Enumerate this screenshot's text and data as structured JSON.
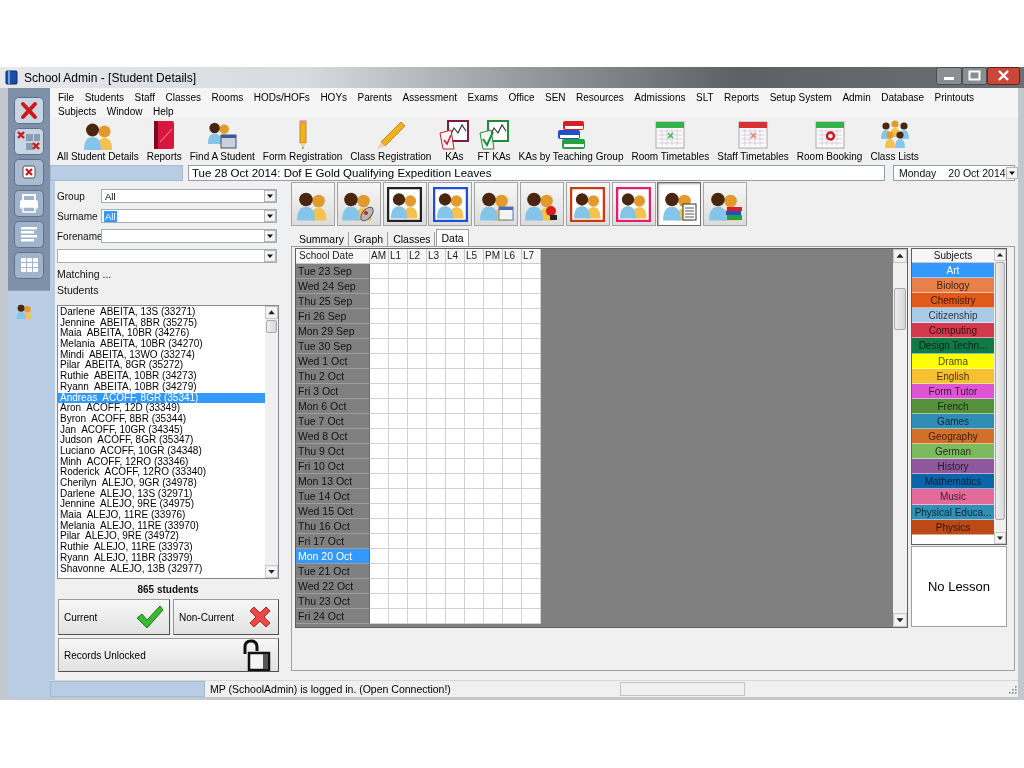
{
  "window": {
    "title": "School Admin - [Student Details]"
  },
  "side_buttons": [
    {
      "kind": "close"
    },
    {
      "kind": "close-all"
    },
    {
      "kind": "close-box"
    },
    {
      "kind": "print"
    },
    {
      "kind": "list"
    },
    {
      "kind": "grid"
    }
  ],
  "menu_rows": [
    [
      "File",
      "Students",
      "Staff",
      "Classes",
      "Rooms",
      "HODs/HOFs",
      "HOYs",
      "Parents",
      "Assessment",
      "Exams",
      "Office",
      "SEN",
      "Resources",
      "Admissions",
      "SLT",
      "Reports",
      "Setup System",
      "Admin",
      "Database",
      "Printouts"
    ],
    [
      "Subjects",
      "Window",
      "Help"
    ]
  ],
  "toolbar": [
    {
      "label": "All Student Details",
      "kind": "people"
    },
    {
      "label": "Reports",
      "kind": "book"
    },
    {
      "label": "Find A Student",
      "kind": "find"
    },
    {
      "label": "Form Registration",
      "kind": "pencil-upright"
    },
    {
      "label": "Class Registration",
      "kind": "pencil"
    },
    {
      "label": "KAs",
      "kind": "chart"
    },
    {
      "label": "FT KAs",
      "kind": "chart-tick"
    },
    {
      "label": "KAs by Teaching Group",
      "kind": "books"
    },
    {
      "label": "Room Timetables",
      "kind": "calendar"
    },
    {
      "label": "Staff Timetables",
      "kind": "calendar-red"
    },
    {
      "label": "Room Booking",
      "kind": "calendar-booking"
    },
    {
      "label": "Class Lists",
      "kind": "group"
    }
  ],
  "notice": "Tue 28 Oct 2014: Dof E Gold Qualifying Expedition Leaves",
  "date_picker": {
    "day": "Monday",
    "date": "20 Oct 2014"
  },
  "filters": [
    {
      "kind": "labeled",
      "label": "Group",
      "value": "All",
      "highlighted": false
    },
    {
      "kind": "labeled",
      "label": "Surname",
      "value": "All",
      "highlighted": true
    },
    {
      "kind": "labeled",
      "label": "Forename"
    },
    {
      "kind": "plain"
    }
  ],
  "matching_label": "Matching ...",
  "students_label": "Students",
  "students": [
    {
      "text": "Darlene  ABEITA, 13S (33271)",
      "selected": false
    },
    {
      "text": "Jennine  ABEITA, 8BR (35275)",
      "selected": false
    },
    {
      "text": "Maia  ABEITA, 10BR (34276)",
      "selected": false
    },
    {
      "text": "Melania  ABEITA, 10BR (34270)",
      "selected": false
    },
    {
      "text": "Mindi  ABEITA, 13WO (33274)",
      "selected": false
    },
    {
      "text": "Pilar  ABEITA, 8GR (35272)",
      "selected": false
    },
    {
      "text": "Ruthie  ABEITA, 10BR (34273)",
      "selected": false
    },
    {
      "text": "Ryann  ABEITA, 10BR (34279)",
      "selected": false
    },
    {
      "text": "Andreas  ACOFF, 8GR (35341)",
      "selected": true
    },
    {
      "text": "Aron  ACOFF, 12D (33349)",
      "selected": false
    },
    {
      "text": "Byron  ACOFF, 8BR (35344)",
      "selected": false
    },
    {
      "text": "Jan  ACOFF, 10GR (34345)",
      "selected": false
    },
    {
      "text": "Judson  ACOFF, 8GR (35347)",
      "selected": false
    },
    {
      "text": "Luciano  ACOFF, 10GR (34348)",
      "selected": false
    },
    {
      "text": "Minh  ACOFF, 12RO (33346)",
      "selected": false
    },
    {
      "text": "Roderick  ACOFF, 12RO (33340)",
      "selected": false
    },
    {
      "text": "Cherilyn  ALEJO, 9GR (34978)",
      "selected": false
    },
    {
      "text": "Darlene  ALEJO, 13S (32971)",
      "selected": false
    },
    {
      "text": "Jennine  ALEJO, 9RE (34975)",
      "selected": false
    },
    {
      "text": "Maia  ALEJO, 11RE (33976)",
      "selected": false
    },
    {
      "text": "Melania  ALEJO, 11RE (33970)",
      "selected": false
    },
    {
      "text": "Pilar  ALEJO, 9RE (34972)",
      "selected": false
    },
    {
      "text": "Ruthie  ALEJO, 11RE (33973)",
      "selected": false
    },
    {
      "text": "Ryann  ALEJO, 11BR (33979)",
      "selected": false
    },
    {
      "text": "Shavonne  ALEJO, 13B (32977)",
      "selected": false
    }
  ],
  "student_count": "865 students",
  "status_buttons": [
    {
      "label": "Current",
      "kind": "current"
    },
    {
      "label": "Non-Current",
      "kind": "non-current"
    }
  ],
  "lock_button": {
    "label": "Records Unlocked",
    "locked": false
  },
  "view_buttons": [
    {
      "kind": "plain",
      "selected": false
    },
    {
      "kind": "mouse",
      "selected": false
    },
    {
      "kind": "framed",
      "selected": false
    },
    {
      "kind": "framed-blue",
      "selected": false
    },
    {
      "kind": "calendar",
      "selected": false
    },
    {
      "kind": "marker",
      "selected": false
    },
    {
      "kind": "framed-red",
      "selected": false
    },
    {
      "kind": "framed-pink",
      "selected": false
    },
    {
      "kind": "document",
      "selected": true
    },
    {
      "kind": "books",
      "selected": false
    }
  ],
  "tabs": [
    {
      "label": "Summary",
      "selected": false
    },
    {
      "label": "Graph",
      "selected": false
    },
    {
      "label": "Classes",
      "selected": false
    },
    {
      "label": "Data",
      "selected": true
    }
  ],
  "attendance": {
    "columns": [
      "School Date",
      "AM",
      "L1",
      "L2",
      "L3",
      "L4",
      "L5",
      "PM",
      "L6",
      "L7"
    ],
    "rows": [
      {
        "date": "Tue 23 Sep",
        "selected": false
      },
      {
        "date": "Wed 24 Sep",
        "selected": false
      },
      {
        "date": "Thu 25 Sep",
        "selected": false
      },
      {
        "date": "Fri 26 Sep",
        "selected": false
      },
      {
        "date": "Mon 29 Sep",
        "selected": false
      },
      {
        "date": "Tue 30 Sep",
        "selected": false
      },
      {
        "date": "Wed 1 Oct",
        "selected": false
      },
      {
        "date": "Thu 2 Oct",
        "selected": false
      },
      {
        "date": "Fri 3 Oct",
        "selected": false
      },
      {
        "date": "Mon 6 Oct",
        "selected": false
      },
      {
        "date": "Tue 7 Oct",
        "selected": false
      },
      {
        "date": "Wed 8 Oct",
        "selected": false
      },
      {
        "date": "Thu 9 Oct",
        "selected": false
      },
      {
        "date": "Fri 10 Oct",
        "selected": false
      },
      {
        "date": "Mon 13 Oct",
        "selected": false
      },
      {
        "date": "Tue 14 Oct",
        "selected": false
      },
      {
        "date": "Wed 15 Oct",
        "selected": false
      },
      {
        "date": "Thu 16 Oct",
        "selected": false
      },
      {
        "date": "Fri 17 Oct",
        "selected": false
      },
      {
        "date": "Mon 20 Oct",
        "selected": true
      },
      {
        "date": "Tue 21 Oct",
        "selected": false
      },
      {
        "date": "Wed 22 Oct",
        "selected": false
      },
      {
        "date": "Thu 23 Oct",
        "selected": false
      },
      {
        "date": "Fri 24 Oct",
        "selected": false
      }
    ]
  },
  "subjects": {
    "heading": "Subjects",
    "items": [
      {
        "name": "Art",
        "selected": true
      },
      {
        "name": "Biology",
        "color": "#e8804a",
        "selected": false
      },
      {
        "name": "Chemistry",
        "color": "#e05a1a",
        "selected": false
      },
      {
        "name": "Citizenship",
        "color": "#a8cce8",
        "selected": false
      },
      {
        "name": "Computing",
        "color": "#d23a4e",
        "selected": false
      },
      {
        "name": "Design Techn...",
        "color": "#0f7a48",
        "selected": false
      },
      {
        "name": "Drama",
        "color": "#ffff00",
        "selected": false
      },
      {
        "name": "English",
        "color": "#f7c030",
        "selected": false
      },
      {
        "name": "Form Tutor",
        "color": "#dd55d5",
        "selected": false
      },
      {
        "name": "French",
        "color": "#55913c",
        "selected": false
      },
      {
        "name": "Games",
        "color": "#2f8db5",
        "selected": false
      },
      {
        "name": "Geography",
        "color": "#d2702a",
        "selected": false
      },
      {
        "name": "German",
        "color": "#7cba60",
        "selected": false
      },
      {
        "name": "History",
        "color": "#8f579e",
        "selected": false
      },
      {
        "name": "Mathematics",
        "color": "#0a66aa",
        "selected": false
      },
      {
        "name": "Music",
        "color": "#e46a9a",
        "selected": false
      },
      {
        "name": "Physical Educa...",
        "color": "#3190b5",
        "selected": false
      },
      {
        "name": "Physics",
        "color": "#bb4a16",
        "selected": false
      }
    ]
  },
  "lesson_panel": {
    "text": "No Lesson"
  },
  "status_bar": {
    "message": "MP (SchoolAdmin) is logged in. (Open Connection!)"
  }
}
